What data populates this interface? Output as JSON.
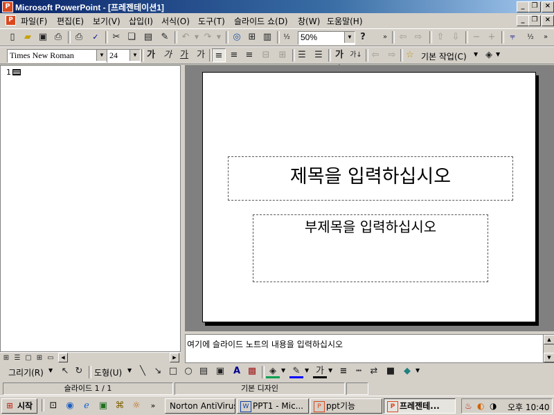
{
  "window": {
    "title": "Microsoft PowerPoint - [프레젠테이션1]",
    "app_icon": "powerpoint-icon"
  },
  "menubar": [
    "파일(F)",
    "편집(E)",
    "보기(V)",
    "삽입(I)",
    "서식(O)",
    "도구(T)",
    "슬라이드 쇼(D)",
    "창(W)",
    "도움말(H)"
  ],
  "standard_toolbar": {
    "icons": [
      "new-icon",
      "open-icon",
      "save-icon",
      "print-icon",
      "print-preview-icon",
      "spelling-icon",
      "cut-icon",
      "copy-icon",
      "paste-icon",
      "format-painter-icon",
      "undo-icon",
      "redo-icon",
      "hyperlink-icon",
      "insert-table-icon",
      "insert-chart-icon",
      "grayscale-icon",
      "help-icon"
    ],
    "zoom": "50%"
  },
  "formatting_toolbar": {
    "font": "Times New Roman",
    "size": "24",
    "style_buttons": [
      "가",
      "가",
      "가",
      "가"
    ],
    "design_label": "기본 작업(C)"
  },
  "outline": {
    "slide_number": "1"
  },
  "slide": {
    "title_placeholder": "제목을 입력하십시오",
    "subtitle_placeholder": "부제목을 입력하십시오"
  },
  "notes": {
    "placeholder": "여기에 슬라이드 노트의 내용을 입력하십시오"
  },
  "drawing_toolbar": {
    "draw_label": "그리기(R)",
    "autoshapes_label": "도형(U)"
  },
  "status": {
    "slide": "슬라이드 1 / 1",
    "design": "기본 디자인"
  },
  "taskbar": {
    "start": "시작",
    "buttons": [
      "Norton AntiVirus",
      "PPT1 - Mic...",
      "ppt기능",
      "프레젠테..."
    ],
    "clock": "오후 10:40"
  }
}
